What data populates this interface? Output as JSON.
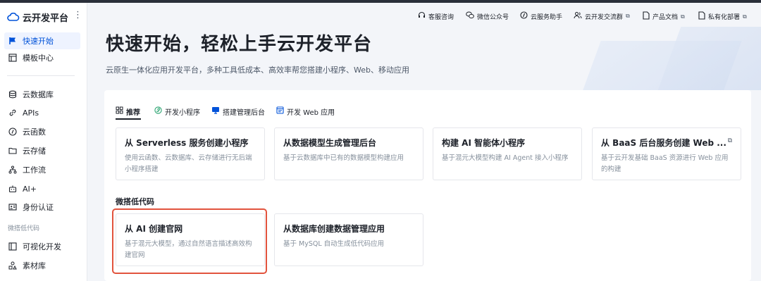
{
  "app": {
    "title": "云开发平台",
    "more": "⋮"
  },
  "sidebar": {
    "items": [
      {
        "label": "快速开始",
        "icon": "flag-icon",
        "active": true
      },
      {
        "label": "模板中心",
        "icon": "template-icon"
      },
      {
        "label": "云数据库",
        "icon": "database-icon"
      },
      {
        "label": "APIs",
        "icon": "link-icon"
      },
      {
        "label": "云函数",
        "icon": "function-icon"
      },
      {
        "label": "云存储",
        "icon": "folder-icon"
      },
      {
        "label": "工作流",
        "icon": "workflow-icon"
      },
      {
        "label": "AI+",
        "icon": "robot-icon"
      },
      {
        "label": "身份认证",
        "icon": "id-card-icon"
      },
      {
        "label": "可视化开发",
        "icon": "layout-icon"
      },
      {
        "label": "素材库",
        "icon": "shapes-icon"
      }
    ],
    "group_label": "微搭低代码"
  },
  "topbar": {
    "items": [
      {
        "label": "客服咨询",
        "icon": "headset-icon"
      },
      {
        "label": "微信公众号",
        "icon": "wechat-icon"
      },
      {
        "label": "云服务助手",
        "icon": "assistant-icon"
      },
      {
        "label": "云开发交流群",
        "icon": "users-icon",
        "external": true
      },
      {
        "label": "产品文档",
        "icon": "document-icon",
        "external": true
      },
      {
        "label": "私有化部署",
        "icon": "document-icon",
        "external": true
      }
    ],
    "external_glyph": "⧉"
  },
  "hero": {
    "title": "快速开始，轻松上手云开发平台",
    "subtitle": "云原生一体化应用开发平台，多种工具低成本、高效率帮您搭建小程序、Web、移动应用"
  },
  "tabs": [
    {
      "label": "推荐",
      "icon": "grid-icon",
      "active": true
    },
    {
      "label": "开发小程序",
      "icon": "miniprogram-icon"
    },
    {
      "label": "搭建管理后台",
      "icon": "monitor-icon"
    },
    {
      "label": "开发 Web 应用",
      "icon": "web-icon"
    }
  ],
  "recommend_cards": [
    {
      "title": "从 Serverless 服务创建小程序",
      "desc": "使用云函数、云数据库、云存储进行无后端小程序搭建"
    },
    {
      "title": "从数据模型生成管理后台",
      "desc": "基于云数据库中已有的数据模型构建应用"
    },
    {
      "title": "构建 AI 智能体小程序",
      "desc": "基于混元大模型构建 AI Agent 接入小程序"
    },
    {
      "title": "从 BaaS 后台服务创建 Web ...",
      "desc": "基于云开发基础 BaaS 资源进行 Web 应用的构建",
      "external": true
    }
  ],
  "lowcode": {
    "title": "微搭低代码",
    "cards": [
      {
        "title": "从 AI 创建官网",
        "desc": "基于混元大模型，通过自然语言描述高效构建官网",
        "highlighted": true
      },
      {
        "title": "从数据库创建数据管理应用",
        "desc": "基于 MySQL 自动生成低代码应用"
      }
    ]
  },
  "colors": {
    "accent": "#0052d9",
    "highlight": "#e2533d"
  }
}
